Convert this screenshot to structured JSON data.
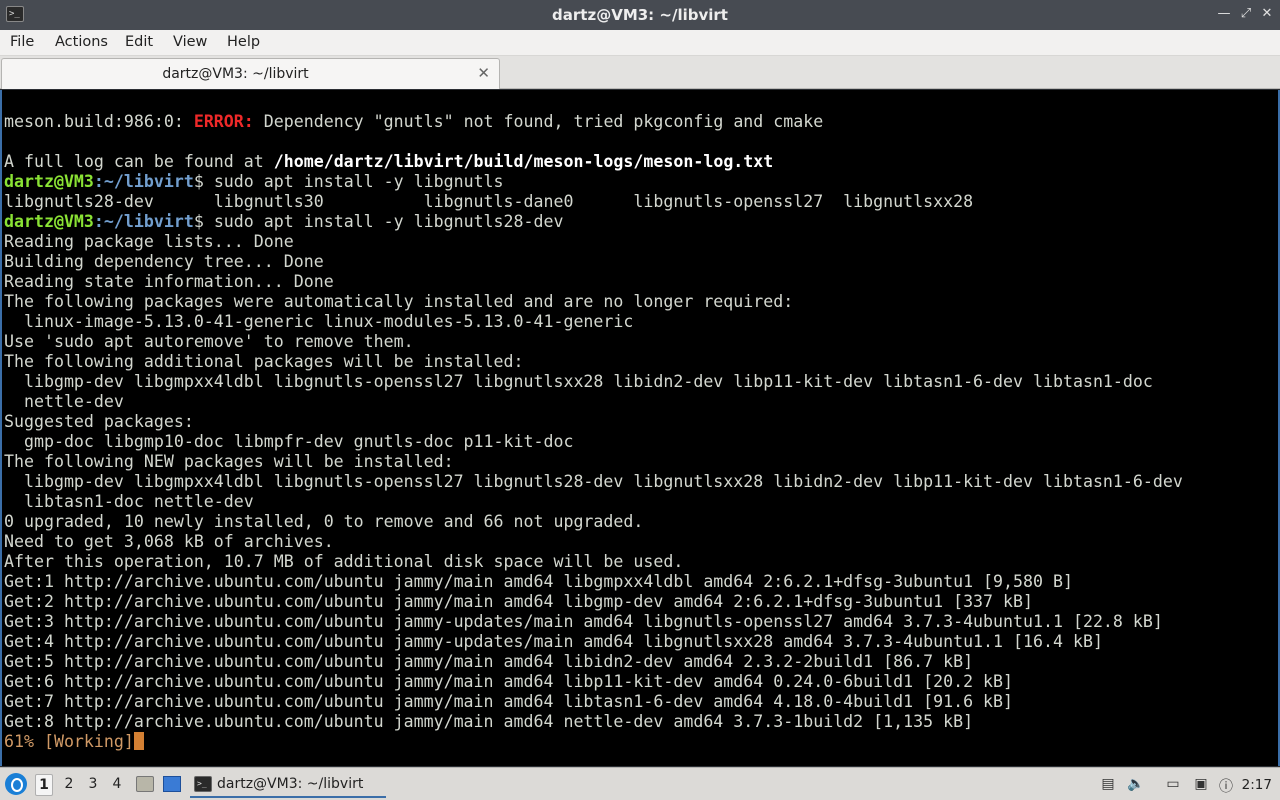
{
  "window": {
    "title": "dartz@VM3: ~/libvirt",
    "app_icon": ">_",
    "btn_minimize": "—",
    "btn_maximize": "⤢",
    "btn_close": "✕"
  },
  "menu": [
    "File",
    "Actions",
    "Edit",
    "View",
    "Help"
  ],
  "tab": {
    "label": "dartz@VM3: ~/libvirt",
    "close": "✕"
  },
  "prompt": {
    "user_host": "dartz@VM3",
    "path": ":~/libvirt",
    "symbol": "$"
  },
  "terminal": {
    "l1": {
      "a": "meson.build:986:0: ",
      "err": "ERROR:",
      "b": " Dependency \"gnutls\" not found, tried pkgconfig and cmake"
    },
    "l3": {
      "a": "A full log can be found at ",
      "path": "/home/dartz/libvirt/build/meson-logs/meson-log.txt"
    },
    "cmd1": " sudo apt install -y libgnutls",
    "completions": "libgnutls28-dev      libgnutls30          libgnutls-dane0      libgnutls-openssl27  libgnutlsxx28",
    "cmd2": " sudo apt install -y libgnutls28-dev",
    "out": [
      "Reading package lists... Done",
      "Building dependency tree... Done",
      "Reading state information... Done",
      "The following packages were automatically installed and are no longer required:",
      "  linux-image-5.13.0-41-generic linux-modules-5.13.0-41-generic",
      "Use 'sudo apt autoremove' to remove them.",
      "The following additional packages will be installed:",
      "  libgmp-dev libgmpxx4ldbl libgnutls-openssl27 libgnutlsxx28 libidn2-dev libp11-kit-dev libtasn1-6-dev libtasn1-doc",
      "  nettle-dev",
      "Suggested packages:",
      "  gmp-doc libgmp10-doc libmpfr-dev gnutls-doc p11-kit-doc",
      "The following NEW packages will be installed:",
      "  libgmp-dev libgmpxx4ldbl libgnutls-openssl27 libgnutls28-dev libgnutlsxx28 libidn2-dev libp11-kit-dev libtasn1-6-dev",
      "  libtasn1-doc nettle-dev",
      "0 upgraded, 10 newly installed, 0 to remove and 66 not upgraded.",
      "Need to get 3,068 kB of archives.",
      "After this operation, 10.7 MB of additional disk space will be used.",
      "Get:1 http://archive.ubuntu.com/ubuntu jammy/main amd64 libgmpxx4ldbl amd64 2:6.2.1+dfsg-3ubuntu1 [9,580 B]",
      "Get:2 http://archive.ubuntu.com/ubuntu jammy/main amd64 libgmp-dev amd64 2:6.2.1+dfsg-3ubuntu1 [337 kB]",
      "Get:3 http://archive.ubuntu.com/ubuntu jammy-updates/main amd64 libgnutls-openssl27 amd64 3.7.3-4ubuntu1.1 [22.8 kB]",
      "Get:4 http://archive.ubuntu.com/ubuntu jammy-updates/main amd64 libgnutlsxx28 amd64 3.7.3-4ubuntu1.1 [16.4 kB]",
      "Get:5 http://archive.ubuntu.com/ubuntu jammy/main amd64 libidn2-dev amd64 2.3.2-2build1 [86.7 kB]",
      "Get:6 http://archive.ubuntu.com/ubuntu jammy/main amd64 libp11-kit-dev amd64 0.24.0-6build1 [20.2 kB]",
      "Get:7 http://archive.ubuntu.com/ubuntu jammy/main amd64 libtasn1-6-dev amd64 4.18.0-4build1 [91.6 kB]",
      "Get:8 http://archive.ubuntu.com/ubuntu jammy/main amd64 nettle-dev amd64 3.7.3-1build2 [1,135 kB]"
    ],
    "progress": "61% [Working]"
  },
  "taskbar": {
    "workspaces": [
      "1",
      "2",
      "3",
      "4"
    ],
    "task_label": "dartz@VM3: ~/libvirt",
    "clock": "2:17"
  },
  "colors": {
    "prompt_user": "#8ae234",
    "prompt_path": "#729fcf",
    "error": "#ef2929",
    "cursor": "#d38033",
    "accent": "#3b6ea8"
  }
}
